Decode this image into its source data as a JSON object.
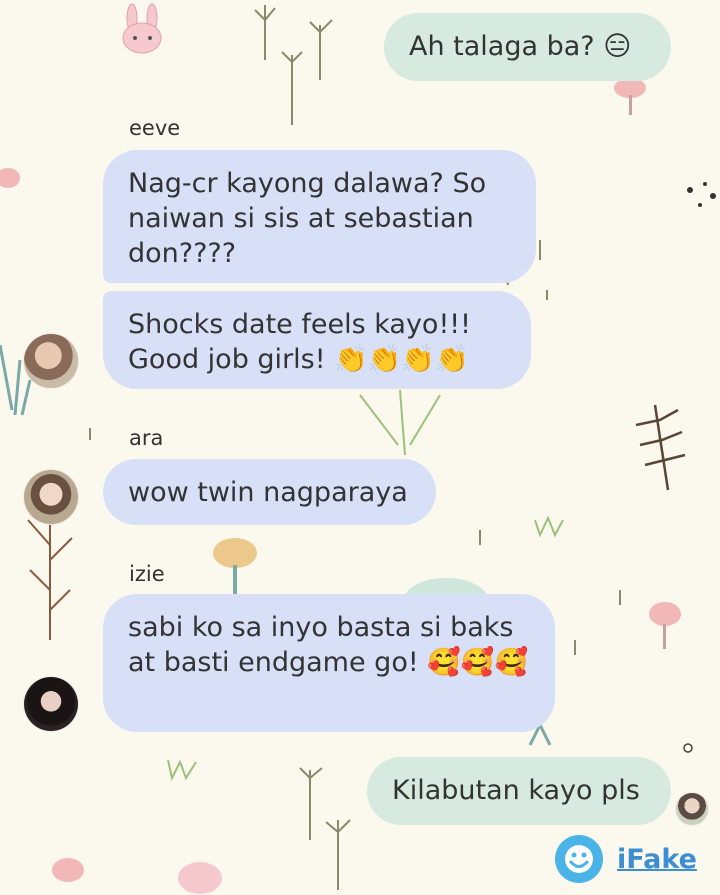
{
  "messages": [
    {
      "sender": "",
      "text": "Ah talaga ba? 😑"
    },
    {
      "sender": "eeve",
      "text": "Nag-cr kayong dalawa? So naiwan si sis at sebastian don????"
    },
    {
      "sender": "",
      "text": "Shocks date feels kayo!!! Good job girls! 👏👏👏👏"
    },
    {
      "sender": "ara",
      "text": "wow twin nagparaya"
    },
    {
      "sender": "izie",
      "text": "sabi ko sa inyo basta si baks at basti endgame go! 🥰🥰🥰"
    },
    {
      "sender": "",
      "text": "Kilabutan kayo pls"
    }
  ],
  "watermark": {
    "label": "iFake",
    "icon": "ifake-smiley-icon",
    "color": "#3c8ed3"
  },
  "colors": {
    "background": "#fbf8ee",
    "incoming_bubble": "#d7e0f6",
    "outgoing_bubble": "#d6eadf"
  }
}
